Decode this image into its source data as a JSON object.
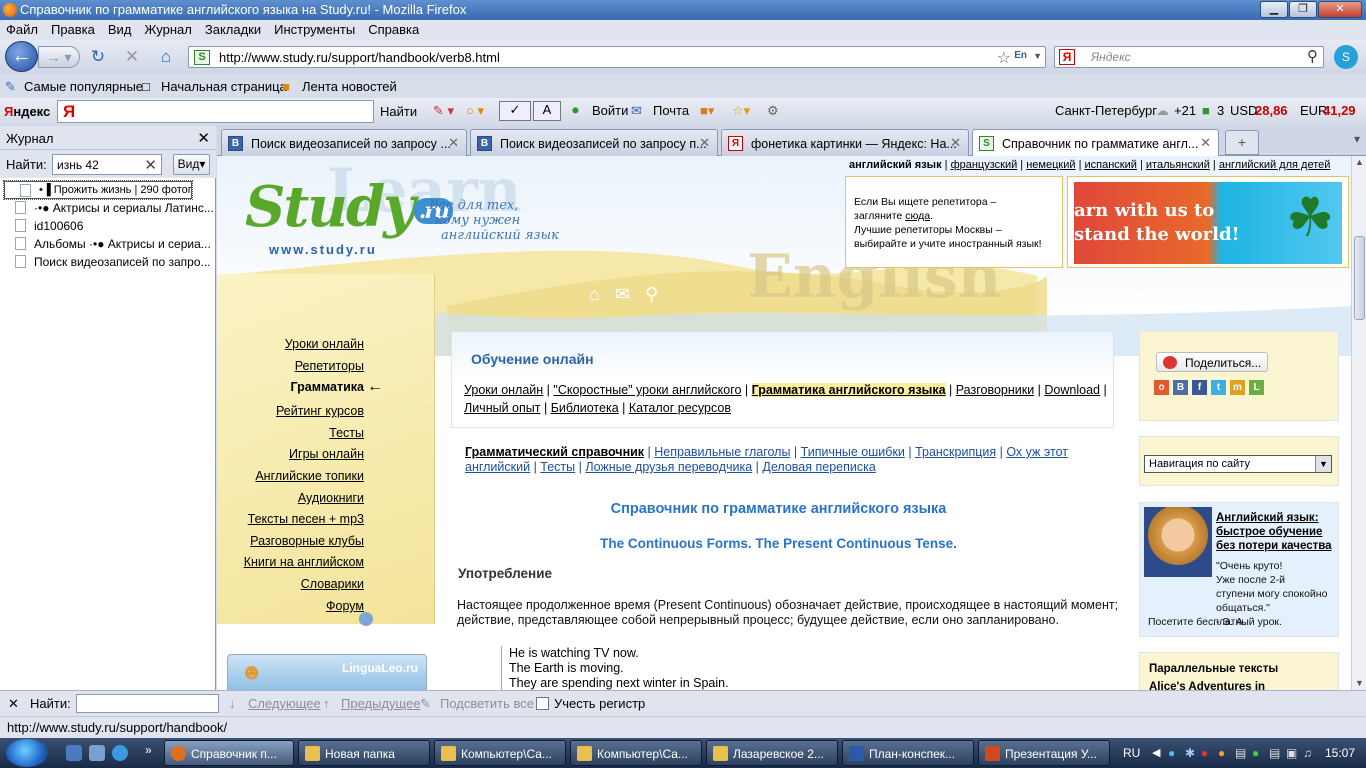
{
  "window": {
    "title": "Справочник по грамматике английского языка на Study.ru! - Mozilla Firefox",
    "min": "▁",
    "max": "❐",
    "close": "✕"
  },
  "menu": [
    "Файл",
    "Правка",
    "Вид",
    "Журнал",
    "Закладки",
    "Инструменты",
    "Справка"
  ],
  "nav": {
    "url": "http://www.study.ru/support/handbook/verb8.html",
    "lang_indicator": "En",
    "search_placeholder": "Яндекс",
    "yandex_logo_char": "Я"
  },
  "bookmarks": [
    "Самые популярные",
    "Начальная страница",
    "Лента новостей"
  ],
  "yandex_bar": {
    "label_ya": "Я",
    "label_rest": "ндекс",
    "find_button": "Найти",
    "mail": "Почта",
    "go": "Войти",
    "city": "Санкт-Петербург",
    "temp": "+21",
    "traffic": "3",
    "usd_label": "USD",
    "usd": "28,86",
    "eur_label": "EUR",
    "eur": "41,29"
  },
  "sidebar": {
    "title": "Журнал",
    "find_label": "Найти:",
    "find_value": "изнь 42",
    "view_button": "Вид",
    "items": [
      "•▐ Прожить жизнь | 290 фотог...",
      "·•● Актрисы и сериалы Латинс...",
      "id100606",
      "Альбомы ·•● Актрисы и сериа...",
      "Поиск видеозаписей по запро..."
    ]
  },
  "tabs": [
    {
      "icon": "В",
      "label": "Поиск видеозаписей по запросу ...",
      "active": false
    },
    {
      "icon": "В",
      "label": "Поиск видеозаписей по запросу п...",
      "active": false
    },
    {
      "icon": "Я",
      "label": "фонетика картинки — Яндекс: На...",
      "active": false
    },
    {
      "icon": "S",
      "label": "Справочник по грамматике англ...",
      "active": true
    }
  ],
  "page": {
    "logo": "Study",
    "logo_ru": ".ru",
    "logo_url": "www.study.ru",
    "slogan": [
      "Все для тех,",
      "кому нужен",
      "английский язык"
    ],
    "bg_words": [
      "Learn",
      "English"
    ],
    "languages": {
      "current": "английский язык",
      "others": [
        "французский",
        "немецкий",
        "испанский",
        "итальянский",
        "английский для детей"
      ]
    },
    "tutor_box": {
      "line1": "Если Вы ищете репетитора –",
      "line2_pre": "загляните ",
      "line2_link": "сюда",
      "line2_post": ".",
      "line3": "Лучшие репетиторы Москвы –",
      "line4": "выбирайте и учите иностранный язык!"
    },
    "banner_text": [
      "arn with us to",
      "stand the world!"
    ],
    "left_nav": [
      "Уроки онлайн",
      "Репетиторы",
      "Грамматика",
      "Рейтинг курсов",
      "Тесты",
      "Игры онлайн",
      "Английские топики",
      "Аудиокниги",
      "Тексты песен + mp3",
      "Разговорные клубы",
      "Книги на английском",
      "Словарики",
      "Форум"
    ],
    "left_nav_current_index": 2,
    "lingualeo": "LinguaLeo.ru",
    "online": {
      "title": "Обучение онлайн",
      "links_row1": [
        "Уроки онлайн",
        "\"Скоростные\" уроки английского",
        "Грамматика английского языка",
        "Разговорники",
        "Download"
      ],
      "links_row2": [
        "Личный опыт",
        "Библиотека",
        "Каталог ресурсов"
      ]
    },
    "sub_links": [
      "Грамматический справочник",
      "Неправильные глаголы",
      "Типичные ошибки",
      "Транскрипция",
      "Ох уж этот английский",
      "Тесты",
      "Ложные друзья переводчика",
      "Деловая переписка"
    ],
    "heading": "Справочник по грамматике английского языка",
    "subheading": "The Continuous Forms. The Present Continuous Tense.",
    "section": "Употребление",
    "paragraph": "Настоящее продолженное время (Present Continuous) обозначает действие, происходящее в настоящий момент; действие, представляющее собой непрерывный процесс; будущее действие, если оно запланировано.",
    "examples": [
      "He is watching TV now.",
      "The Earth is moving.",
      "They are spending next winter in Spain."
    ],
    "right": {
      "share": "Поделиться...",
      "nav_select": "Навигация по сайту",
      "promo_title": "Английский язык: быстрое обучение без потери качества",
      "promo_quote": "\"Очень круто!\nУже после 2-й\nступени могу спокойно общаться.\"",
      "promo_sign": "- Э. А.",
      "promo_cta": "Посетите бесплатный урок.",
      "parallel_title": "Параллельные тексты",
      "parallel_item": "Alice's Adventures in"
    }
  },
  "findbar": {
    "label": "Найти:",
    "next": "Следующее",
    "prev": "Предыдущее",
    "highlight": "Подсветить все",
    "matchcase": "Учесть регистр"
  },
  "status": "http://www.study.ru/support/handbook/",
  "taskbar": {
    "items": [
      {
        "label": "Справочник п...",
        "active": true
      },
      {
        "label": "Новая папка",
        "active": false
      },
      {
        "label": "Компьютер\\Са...",
        "active": false
      },
      {
        "label": "Компьютер\\Са...",
        "active": false
      },
      {
        "label": "Лазаревское 2...",
        "active": false
      },
      {
        "label": "План-конспек...",
        "active": false
      },
      {
        "label": "Презентация У...",
        "active": false
      }
    ],
    "lang": "RU",
    "time": "15:07"
  },
  "colors": {
    "accent_blue": "#2a74c8",
    "nav_yellow": "#fbf3c6",
    "link_blue": "#1d4fa0"
  }
}
